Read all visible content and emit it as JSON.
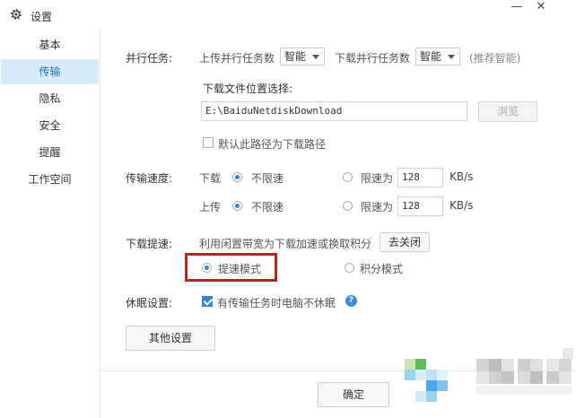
{
  "window": {
    "title": "设置",
    "minimize": "—",
    "close": "✕"
  },
  "sidebar": {
    "items": [
      {
        "label": "基本"
      },
      {
        "label": "传输",
        "active": true
      },
      {
        "label": "隐私"
      },
      {
        "label": "安全"
      },
      {
        "label": "提醒"
      },
      {
        "label": "工作空间"
      }
    ]
  },
  "tasks": {
    "label": "并行任务:",
    "upload_label": "上传并行任务数",
    "upload_value": "智能",
    "download_label": "下载并行任务数",
    "download_value": "智能",
    "hint": "(推荐智能)"
  },
  "download_location": {
    "label": "下载文件位置选择:",
    "path": "E:\\BaiduNetdiskDownload",
    "browse_label": "浏览",
    "default_checkbox_label": "默认此路径为下载路径",
    "default_checked": false
  },
  "speed": {
    "label": "传输速度:",
    "download": {
      "label": "下载",
      "unlimited_label": "不限速",
      "limit_label": "限速为",
      "limit_value": "128",
      "unit": "KB/s",
      "selected": "unlimited"
    },
    "upload": {
      "label": "上传",
      "unlimited_label": "不限速",
      "limit_label": "限速为",
      "limit_value": "128",
      "unit": "KB/s",
      "selected": "unlimited"
    }
  },
  "accelerate": {
    "label": "下载提速:",
    "description": "利用闲置带宽为下载加速或换取积分",
    "close_button": "去关闭",
    "speed_mode_label": "提速模式",
    "points_mode_label": "积分模式",
    "selected": "speed"
  },
  "sleep": {
    "label": "休眠设置:",
    "checkbox_label": "有传输任务时电脑不休眠",
    "checked": true
  },
  "other_settings_button": "其他设置",
  "ok_button": "确定",
  "colors": {
    "accent": "#2f86d6",
    "active_bg": "#d6ecfb",
    "highlight_border": "#b3261e"
  }
}
